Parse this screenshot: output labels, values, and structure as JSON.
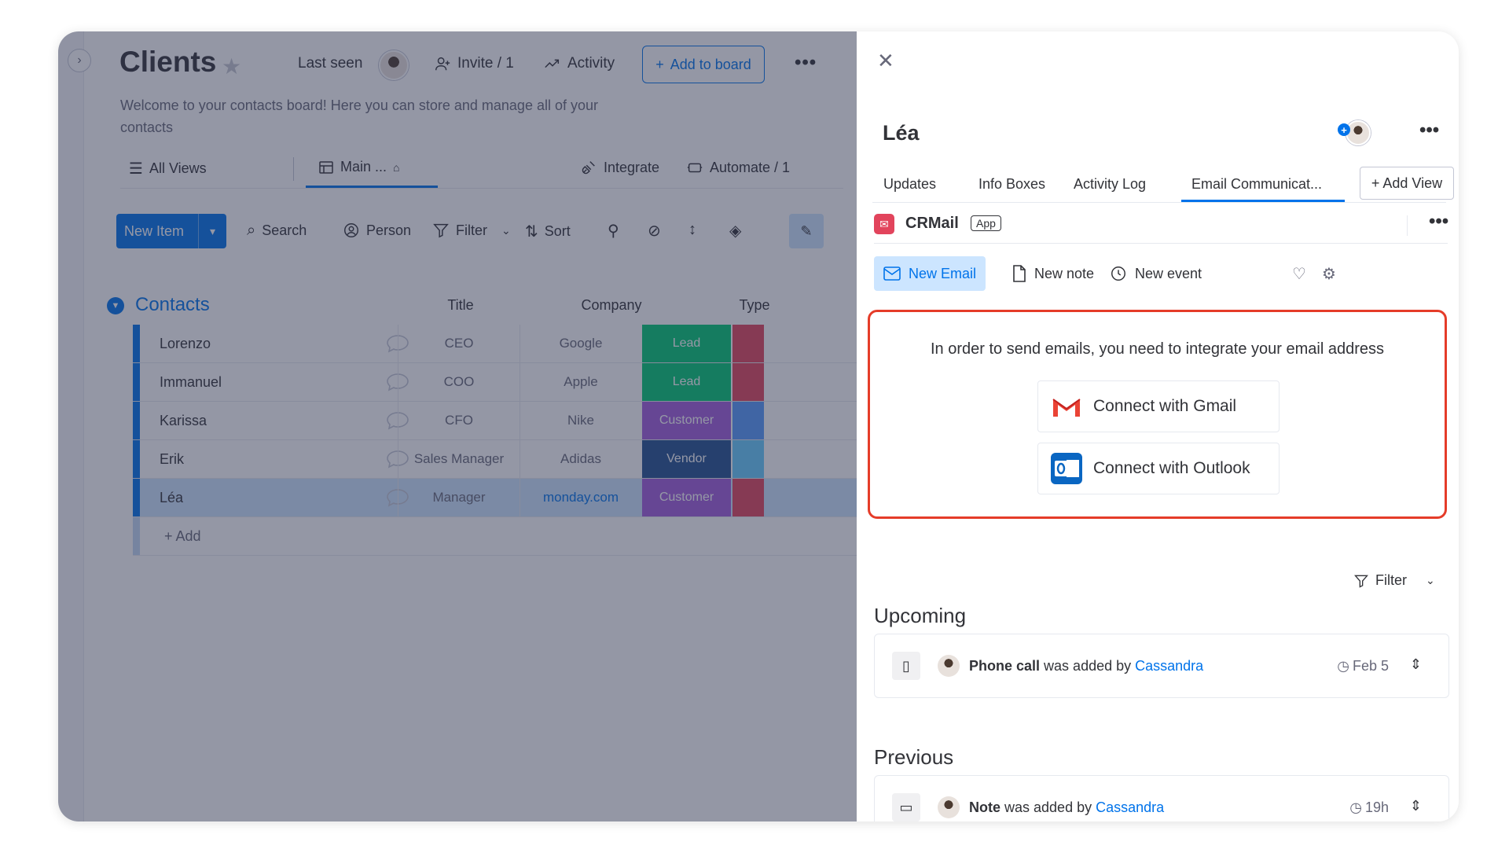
{
  "board": {
    "title": "Clients",
    "last_seen_label": "Last seen",
    "invite_label": "Invite / 1",
    "activity_label": "Activity",
    "add_to_board_label": "Add to board",
    "description": "Welcome to your contacts board! Here you can store and manage all of your contacts",
    "views": {
      "all_views": "All Views",
      "main": "Main ...",
      "integrate": "Integrate",
      "automate": "Automate / 1"
    },
    "toolbar": {
      "new_item": "New Item",
      "search": "Search",
      "person": "Person",
      "filter": "Filter",
      "sort": "Sort"
    },
    "group": {
      "name": "Contacts",
      "columns": [
        "Title",
        "Company",
        "Type"
      ],
      "rows": [
        {
          "name": "Lorenzo",
          "title": "CEO",
          "company": "Google",
          "type": "Lead",
          "type_color": "#00c875",
          "extra_color": "#e2445c",
          "company_link": false
        },
        {
          "name": "Immanuel",
          "title": "COO",
          "company": "Apple",
          "type": "Lead",
          "type_color": "#00c875",
          "extra_color": "#e2445c",
          "company_link": false
        },
        {
          "name": "Karissa",
          "title": "CFO",
          "company": "Nike",
          "type": "Customer",
          "type_color": "#a25ddc",
          "extra_color": "#579bfc",
          "company_link": false
        },
        {
          "name": "Erik",
          "title": "Sales Manager",
          "company": "Adidas",
          "type": "Vendor",
          "type_color": "#225091",
          "extra_color": "#66ccff",
          "company_link": false
        },
        {
          "name": "Léa",
          "title": "Manager",
          "company": "monday.com",
          "type": "Customer",
          "type_color": "#a25ddc",
          "extra_color": "#e2445c",
          "company_link": true
        }
      ],
      "add_label": "+ Add"
    }
  },
  "panel": {
    "item_name": "Léa",
    "tabs": [
      "Updates",
      "Info Boxes",
      "Activity Log",
      "Email Communicat..."
    ],
    "add_view_label": "+ Add View",
    "app_name": "CRMail",
    "app_badge": "App",
    "compose": {
      "new_email": "New Email",
      "new_note": "New note",
      "new_event": "New event"
    },
    "integrate": {
      "message": "In order to send emails, you need to integrate your email address",
      "gmail_label": "Connect with Gmail",
      "outlook_label": "Connect with Outlook"
    },
    "filter_label": "Filter",
    "upcoming": {
      "title": "Upcoming",
      "item": {
        "kind": "Phone call",
        "added_by_text": "was added by",
        "author": "Cassandra",
        "when": "Feb 5"
      }
    },
    "previous": {
      "title": "Previous",
      "item": {
        "kind": "Note",
        "added_by_text": "was added by",
        "author": "Cassandra",
        "when": "19h"
      }
    }
  },
  "colors": {
    "accent": "#0073ea",
    "highlight_border": "#e53c29"
  }
}
